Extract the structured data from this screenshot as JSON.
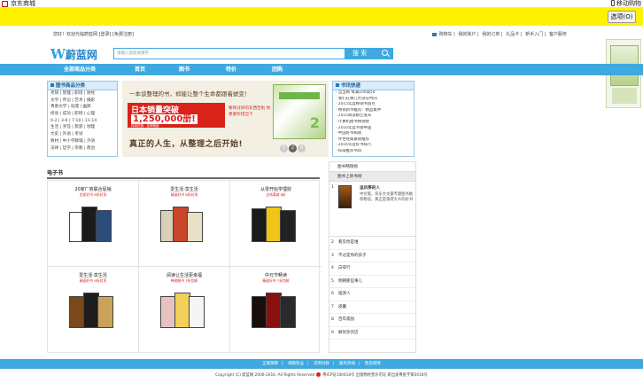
{
  "window": {
    "title": "京东商城",
    "mobile_label": "移动购物"
  },
  "infobar": {
    "options_button": "选项(O)"
  },
  "toplinks": {
    "welcome": "您好！欢迎光临蔚蓝网 [登录] [免费注册]",
    "items": [
      "购物车",
      "我的账户",
      "我的订单",
      "礼品卡",
      "新手入门",
      "客户服务"
    ]
  },
  "brand": {
    "name": "蔚蓝网",
    "mark": "W"
  },
  "search": {
    "placeholder": "请输入搜索关键字",
    "button": "搜 索"
  },
  "nav": {
    "items": [
      "全部商品分类",
      "首页",
      "图书",
      "特价",
      "团购"
    ]
  },
  "category": {
    "title": "图书商品分类",
    "rows": [
      "考研 | 管理 | 职场 | 财经",
      "文学 | 传记 | 艺术 | 摄影",
      "青春文学 | 动漫 | 幽默",
      "修身 | 成功 | 职场 | 心理",
      "0-2 | 3-6 | 7-10 | 11-14",
      "生活 | 烹饪 | 旅游 | 地理",
      "文史 | 外语 | 考试",
      "教材 | 中小学教辅 | 外语",
      "法律 | 哲学 | 宗教 | 政治"
    ]
  },
  "banner": {
    "tagline": "一本谈整理的书，却能让整个生命都跟着蜕变！",
    "sales_line": "日本销量突破",
    "sales_number": "1,250,000册!",
    "sales_sub": "持续热销 · 全球畅销",
    "red_text": "要和讨厌的东西告别 你更要珍惜当下",
    "slogan": "真正的人生，从整理之后开始!",
    "book_number": "2",
    "dots": [
      "1",
      "2",
      "3"
    ]
  },
  "news": {
    "title": "书讯快递",
    "rows": [
      "当当网 每满100减50",
      "我们在哪儿大部分时间 ",
      "2015年度畅销书盘点",
      "畅销新书推荐：精品集中",
      "2015阅读报告发布",
      "计算机图书畅销榜",
      "2016年度书香中国",
      "中国好书揭晓",
      "传世经典重磅推荐",
      "2016年度好书排行",
      "权威推荐书目"
    ]
  },
  "ebook": {
    "title": "电子书",
    "cells": [
      {
        "title": "20家厂商联合促销",
        "sub": "优质好书 6折封顶"
      },
      {
        "title": "爱生活·享生活",
        "sub": "精选好书 6折封顶"
      },
      {
        "title": "从零开始学理财",
        "sub": "全场满减 8折"
      },
      {
        "title": "爱生活·享生活",
        "sub": "精选好书 6折封顶"
      },
      {
        "title": "阅读让生活更幸福",
        "sub": "畅销图书 7折包邮"
      },
      {
        "title": "中元节畅读",
        "sub": "精选好书 7折包邮"
      }
    ]
  },
  "ranking": {
    "tabs": [
      "图书畅销榜",
      "图书上新书榜"
    ],
    "featured": {
      "num": "1",
      "name": "追风筝的人",
      "desc": "中文版，快乐大文豪专题图书推荐畅读，真正是值得大众的好书"
    },
    "rows": [
      {
        "num": "2",
        "text": "看见你是谁"
      },
      {
        "num": "3",
        "text": "不过是你的孩子"
      },
      {
        "num": "4",
        "text": "白夜行"
      },
      {
        "num": "5",
        "text": "明朝那些事儿"
      },
      {
        "num": "6",
        "text": "摆渡人"
      },
      {
        "num": "7",
        "text": "皮囊"
      },
      {
        "num": "8",
        "text": "百年孤独"
      },
      {
        "num": "9",
        "text": "解忧杂货店"
      }
    ]
  },
  "footer": {
    "links": [
      "正版保障",
      "满额免运",
      "货到付款",
      "服务热线",
      "售后保障"
    ],
    "copyright": "Copyright (C) 蔚蓝网 2006-2016, All Rights Reserved",
    "icp": "粤ICP证100418号 出版物经营许可证 新出发粤批字第0018号"
  }
}
